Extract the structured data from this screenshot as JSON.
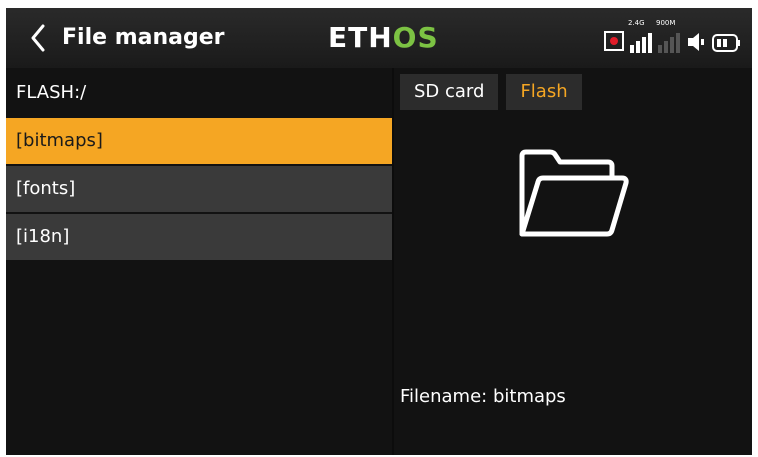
{
  "header": {
    "back_icon": "chevron-left-icon",
    "title": "File manager",
    "logo_main": "ETH",
    "logo_accent": "OS",
    "accent_color": "#7cc243",
    "status": {
      "recording_icon": "record-icon",
      "signal_24": "2.4G",
      "signal_900": "900M",
      "speaker_icon": "speaker-icon",
      "battery_icon": "battery-icon"
    }
  },
  "left": {
    "path": "FLASH:/",
    "items": [
      {
        "label": "[bitmaps]",
        "selected": true
      },
      {
        "label": "[fonts]",
        "selected": false
      },
      {
        "label": "[i18n]",
        "selected": false
      }
    ]
  },
  "right": {
    "tabs": [
      {
        "label": "SD card",
        "active": false
      },
      {
        "label": "Flash",
        "active": true
      }
    ],
    "preview_icon": "folder-open-icon",
    "filename": "Filename: bitmaps"
  },
  "colors": {
    "selection": "#f5a623",
    "background": "#121212",
    "item_bg": "#3a3a3a"
  }
}
